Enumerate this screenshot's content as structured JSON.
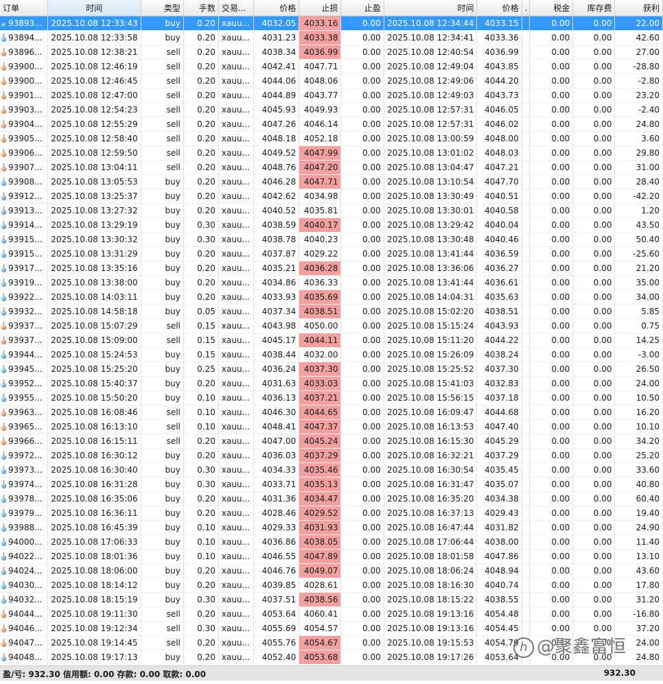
{
  "columns": {
    "order": "订单",
    "time": "时间",
    "type": "类型",
    "volume": "手数",
    "symbol": "交易...",
    "price": "价格",
    "sl": "止损",
    "tp": "止盈",
    "close_time": "时间",
    "close_price": "价格",
    "dot": ".",
    "tax": "税金",
    "swap": "库存费",
    "profit": "获利"
  },
  "rows": [
    {
      "order": "93893...",
      "time": "2025.10.08 12:33:43",
      "type": "buy",
      "volume": "0.20",
      "symbol": "xauu...",
      "price": "4032.05",
      "sl": "4033.16",
      "tp": "0.00",
      "close_time": "2025.10.08 12:34:44",
      "close_price": "4033.15",
      "tax": "0.00",
      "swap": "0.00",
      "profit": "22.00",
      "sl_hl": true,
      "selected": true
    },
    {
      "order": "93894...",
      "time": "2025.10.08 12:33:58",
      "type": "buy",
      "volume": "0.20",
      "symbol": "xauu...",
      "price": "4031.23",
      "sl": "4033.38",
      "tp": "0.00",
      "close_time": "2025.10.08 12:34:41",
      "close_price": "4033.36",
      "tax": "0.00",
      "swap": "0.00",
      "profit": "42.60",
      "sl_hl": true
    },
    {
      "order": "93896...",
      "time": "2025.10.08 12:38:21",
      "type": "sell",
      "volume": "0.20",
      "symbol": "xauu...",
      "price": "4038.34",
      "sl": "4036.99",
      "tp": "0.00",
      "close_time": "2025.10.08 12:40:54",
      "close_price": "4036.99",
      "tax": "0.00",
      "swap": "0.00",
      "profit": "27.00",
      "sl_hl": true
    },
    {
      "order": "93900...",
      "time": "2025.10.08 12:46:19",
      "type": "sell",
      "volume": "0.20",
      "symbol": "xauu...",
      "price": "4042.41",
      "sl": "4047.71",
      "tp": "0.00",
      "close_time": "2025.10.08 12:49:04",
      "close_price": "4043.85",
      "tax": "0.00",
      "swap": "0.00",
      "profit": "-28.80",
      "sl_hl": false
    },
    {
      "order": "93900...",
      "time": "2025.10.08 12:46:45",
      "type": "sell",
      "volume": "0.20",
      "symbol": "xauu...",
      "price": "4044.06",
      "sl": "4048.06",
      "tp": "0.00",
      "close_time": "2025.10.08 12:49:06",
      "close_price": "4044.20",
      "tax": "0.00",
      "swap": "0.00",
      "profit": "-2.80",
      "sl_hl": false
    },
    {
      "order": "93901...",
      "time": "2025.10.08 12:47:00",
      "type": "sell",
      "volume": "0.20",
      "symbol": "xauu...",
      "price": "4044.89",
      "sl": "4043.77",
      "tp": "0.00",
      "close_time": "2025.10.08 12:49:03",
      "close_price": "4043.73",
      "tax": "0.00",
      "swap": "0.00",
      "profit": "23.20",
      "sl_hl": false
    },
    {
      "order": "93903...",
      "time": "2025.10.08 12:54:23",
      "type": "sell",
      "volume": "0.20",
      "symbol": "xauu...",
      "price": "4045.93",
      "sl": "4049.93",
      "tp": "0.00",
      "close_time": "2025.10.08 12:57:31",
      "close_price": "4046.05",
      "tax": "0.00",
      "swap": "0.00",
      "profit": "-2.40",
      "sl_hl": false
    },
    {
      "order": "93904...",
      "time": "2025.10.08 12:55:29",
      "type": "sell",
      "volume": "0.20",
      "symbol": "xauu...",
      "price": "4047.26",
      "sl": "4046.14",
      "tp": "0.00",
      "close_time": "2025.10.08 12:57:31",
      "close_price": "4046.02",
      "tax": "0.00",
      "swap": "0.00",
      "profit": "24.80",
      "sl_hl": false
    },
    {
      "order": "93905...",
      "time": "2025.10.08 12:58:40",
      "type": "sell",
      "volume": "0.20",
      "symbol": "xauu...",
      "price": "4048.18",
      "sl": "4052.18",
      "tp": "0.00",
      "close_time": "2025.10.08 13:00:59",
      "close_price": "4048.00",
      "tax": "0.00",
      "swap": "0.00",
      "profit": "3.60",
      "sl_hl": false
    },
    {
      "order": "93906...",
      "time": "2025.10.08 12:59:50",
      "type": "sell",
      "volume": "0.20",
      "symbol": "xauu...",
      "price": "4049.52",
      "sl": "4047.99",
      "tp": "0.00",
      "close_time": "2025.10.08 13:01:02",
      "close_price": "4048.03",
      "tax": "0.00",
      "swap": "0.00",
      "profit": "29.80",
      "sl_hl": true
    },
    {
      "order": "93907...",
      "time": "2025.10.08 13:04:11",
      "type": "sell",
      "volume": "0.20",
      "symbol": "xauu...",
      "price": "4048.76",
      "sl": "4047.20",
      "tp": "0.00",
      "close_time": "2025.10.08 13:04:47",
      "close_price": "4047.21",
      "tax": "0.00",
      "swap": "0.00",
      "profit": "31.00",
      "sl_hl": true
    },
    {
      "order": "93908...",
      "time": "2025.10.08 13:05:53",
      "type": "buy",
      "volume": "0.20",
      "symbol": "xauu...",
      "price": "4046.28",
      "sl": "4047.71",
      "tp": "0.00",
      "close_time": "2025.10.08 13:10:54",
      "close_price": "4047.70",
      "tax": "0.00",
      "swap": "0.00",
      "profit": "28.40",
      "sl_hl": true
    },
    {
      "order": "93912...",
      "time": "2025.10.08 13:25:37",
      "type": "buy",
      "volume": "0.20",
      "symbol": "xauu...",
      "price": "4042.62",
      "sl": "4034.98",
      "tp": "0.00",
      "close_time": "2025.10.08 13:30:49",
      "close_price": "4040.51",
      "tax": "0.00",
      "swap": "0.00",
      "profit": "-42.20",
      "sl_hl": false
    },
    {
      "order": "93913...",
      "time": "2025.10.08 13:27:32",
      "type": "buy",
      "volume": "0.20",
      "symbol": "xauu...",
      "price": "4040.52",
      "sl": "4035.81",
      "tp": "0.00",
      "close_time": "2025.10.08 13:30:01",
      "close_price": "4040.58",
      "tax": "0.00",
      "swap": "0.00",
      "profit": "1.20",
      "sl_hl": false
    },
    {
      "order": "93914...",
      "time": "2025.10.08 13:29:19",
      "type": "buy",
      "volume": "0.30",
      "symbol": "xauu...",
      "price": "4038.59",
      "sl": "4040.17",
      "tp": "0.00",
      "close_time": "2025.10.08 13:29:42",
      "close_price": "4040.04",
      "tax": "0.00",
      "swap": "0.00",
      "profit": "43.50",
      "sl_hl": true
    },
    {
      "order": "93915...",
      "time": "2025.10.08 13:30:32",
      "type": "buy",
      "volume": "0.30",
      "symbol": "xauu...",
      "price": "4038.78",
      "sl": "4040.23",
      "tp": "0.00",
      "close_time": "2025.10.08 13:30:48",
      "close_price": "4040.46",
      "tax": "0.00",
      "swap": "0.00",
      "profit": "50.40",
      "sl_hl": false
    },
    {
      "order": "93915...",
      "time": "2025.10.08 13:31:29",
      "type": "buy",
      "volume": "0.20",
      "symbol": "xauu...",
      "price": "4037.87",
      "sl": "4029.22",
      "tp": "0.00",
      "close_time": "2025.10.08 13:41:44",
      "close_price": "4036.59",
      "tax": "0.00",
      "swap": "0.00",
      "profit": "-25.60",
      "sl_hl": false
    },
    {
      "order": "93917...",
      "time": "2025.10.08 13:35:16",
      "type": "buy",
      "volume": "0.20",
      "symbol": "xauu...",
      "price": "4035.21",
      "sl": "4036.28",
      "tp": "0.00",
      "close_time": "2025.10.08 13:36:06",
      "close_price": "4036.27",
      "tax": "0.00",
      "swap": "0.00",
      "profit": "21.20",
      "sl_hl": true
    },
    {
      "order": "93919...",
      "time": "2025.10.08 13:38:00",
      "type": "buy",
      "volume": "0.20",
      "symbol": "xauu...",
      "price": "4034.86",
      "sl": "4036.33",
      "tp": "0.00",
      "close_time": "2025.10.08 13:41:44",
      "close_price": "4036.61",
      "tax": "0.00",
      "swap": "0.00",
      "profit": "35.00",
      "sl_hl": false
    },
    {
      "order": "93922...",
      "time": "2025.10.08 14:03:11",
      "type": "buy",
      "volume": "0.20",
      "symbol": "xauu...",
      "price": "4033.93",
      "sl": "4035.69",
      "tp": "0.00",
      "close_time": "2025.10.08 14:04:31",
      "close_price": "4035.63",
      "tax": "0.00",
      "swap": "0.00",
      "profit": "34.00",
      "sl_hl": true
    },
    {
      "order": "93932...",
      "time": "2025.10.08 14:58:18",
      "type": "buy",
      "volume": "0.05",
      "symbol": "xauu...",
      "price": "4037.34",
      "sl": "4038.51",
      "tp": "0.00",
      "close_time": "2025.10.08 15:02:20",
      "close_price": "4038.51",
      "tax": "0.00",
      "swap": "0.00",
      "profit": "5.85",
      "sl_hl": true
    },
    {
      "order": "93937...",
      "time": "2025.10.08 15:07:29",
      "type": "sell",
      "volume": "0.15",
      "symbol": "xauu...",
      "price": "4043.98",
      "sl": "4050.00",
      "tp": "0.00",
      "close_time": "2025.10.08 15:15:24",
      "close_price": "4043.93",
      "tax": "0.00",
      "swap": "0.00",
      "profit": "0.75",
      "sl_hl": false
    },
    {
      "order": "93937...",
      "time": "2025.10.08 15:09:00",
      "type": "sell",
      "volume": "0.15",
      "symbol": "xauu...",
      "price": "4045.17",
      "sl": "4044.11",
      "tp": "0.00",
      "close_time": "2025.10.08 15:11:20",
      "close_price": "4044.22",
      "tax": "0.00",
      "swap": "0.00",
      "profit": "14.25",
      "sl_hl": true
    },
    {
      "order": "93944...",
      "time": "2025.10.08 15:24:53",
      "type": "buy",
      "volume": "0.15",
      "symbol": "xauu...",
      "price": "4038.44",
      "sl": "4032.00",
      "tp": "0.00",
      "close_time": "2025.10.08 15:26:09",
      "close_price": "4038.24",
      "tax": "0.00",
      "swap": "0.00",
      "profit": "-3.00",
      "sl_hl": false
    },
    {
      "order": "93945...",
      "time": "2025.10.08 15:25:20",
      "type": "buy",
      "volume": "0.25",
      "symbol": "xauu...",
      "price": "4036.24",
      "sl": "4037.30",
      "tp": "0.00",
      "close_time": "2025.10.08 15:25:52",
      "close_price": "4037.30",
      "tax": "0.00",
      "swap": "0.00",
      "profit": "26.50",
      "sl_hl": true
    },
    {
      "order": "93952...",
      "time": "2025.10.08 15:40:37",
      "type": "buy",
      "volume": "0.20",
      "symbol": "xauu...",
      "price": "4031.63",
      "sl": "4033.03",
      "tp": "0.00",
      "close_time": "2025.10.08 15:41:03",
      "close_price": "4032.83",
      "tax": "0.00",
      "swap": "0.00",
      "profit": "24.00",
      "sl_hl": true
    },
    {
      "order": "93955...",
      "time": "2025.10.08 15:50:20",
      "type": "buy",
      "volume": "0.10",
      "symbol": "xauu...",
      "price": "4036.13",
      "sl": "4037.21",
      "tp": "0.00",
      "close_time": "2025.10.08 15:56:15",
      "close_price": "4037.18",
      "tax": "0.00",
      "swap": "0.00",
      "profit": "10.50",
      "sl_hl": true
    },
    {
      "order": "93963...",
      "time": "2025.10.08 16:08:46",
      "type": "sell",
      "volume": "0.10",
      "symbol": "xauu...",
      "price": "4046.30",
      "sl": "4044.65",
      "tp": "0.00",
      "close_time": "2025.10.08 16:09:47",
      "close_price": "4044.68",
      "tax": "0.00",
      "swap": "0.00",
      "profit": "16.20",
      "sl_hl": true
    },
    {
      "order": "93965...",
      "time": "2025.10.08 16:13:10",
      "type": "sell",
      "volume": "0.10",
      "symbol": "xauu...",
      "price": "4048.41",
      "sl": "4047.37",
      "tp": "0.00",
      "close_time": "2025.10.08 16:13:53",
      "close_price": "4047.40",
      "tax": "0.00",
      "swap": "0.00",
      "profit": "10.10",
      "sl_hl": true
    },
    {
      "order": "93966...",
      "time": "2025.10.08 16:15:11",
      "type": "sell",
      "volume": "0.20",
      "symbol": "xauu...",
      "price": "4047.00",
      "sl": "4045.24",
      "tp": "0.00",
      "close_time": "2025.10.08 16:15:30",
      "close_price": "4045.29",
      "tax": "0.00",
      "swap": "0.00",
      "profit": "34.20",
      "sl_hl": true
    },
    {
      "order": "93972...",
      "time": "2025.10.08 16:30:12",
      "type": "buy",
      "volume": "0.20",
      "symbol": "xauu...",
      "price": "4036.03",
      "sl": "4037.29",
      "tp": "0.00",
      "close_time": "2025.10.08 16:32:21",
      "close_price": "4037.29",
      "tax": "0.00",
      "swap": "0.00",
      "profit": "25.20",
      "sl_hl": true
    },
    {
      "order": "93973...",
      "time": "2025.10.08 16:30:40",
      "type": "buy",
      "volume": "0.30",
      "symbol": "xauu...",
      "price": "4034.33",
      "sl": "4035.46",
      "tp": "0.00",
      "close_time": "2025.10.08 16:30:54",
      "close_price": "4035.45",
      "tax": "0.00",
      "swap": "0.00",
      "profit": "33.60",
      "sl_hl": true
    },
    {
      "order": "93974...",
      "time": "2025.10.08 16:31:28",
      "type": "buy",
      "volume": "0.30",
      "symbol": "xauu...",
      "price": "4033.71",
      "sl": "4035.13",
      "tp": "0.00",
      "close_time": "2025.10.08 16:31:47",
      "close_price": "4035.07",
      "tax": "0.00",
      "swap": "0.00",
      "profit": "40.80",
      "sl_hl": true
    },
    {
      "order": "93978...",
      "time": "2025.10.08 16:35:06",
      "type": "buy",
      "volume": "0.20",
      "symbol": "xauu...",
      "price": "4031.36",
      "sl": "4034.47",
      "tp": "0.00",
      "close_time": "2025.10.08 16:35:20",
      "close_price": "4034.38",
      "tax": "0.00",
      "swap": "0.00",
      "profit": "60.40",
      "sl_hl": true
    },
    {
      "order": "93979...",
      "time": "2025.10.08 16:36:11",
      "type": "buy",
      "volume": "0.20",
      "symbol": "xauu...",
      "price": "4028.46",
      "sl": "4029.52",
      "tp": "0.00",
      "close_time": "2025.10.08 16:37:13",
      "close_price": "4029.43",
      "tax": "0.00",
      "swap": "0.00",
      "profit": "19.40",
      "sl_hl": true
    },
    {
      "order": "93988...",
      "time": "2025.10.08 16:45:39",
      "type": "buy",
      "volume": "0.10",
      "symbol": "xauu...",
      "price": "4029.33",
      "sl": "4031.93",
      "tp": "0.00",
      "close_time": "2025.10.08 16:47:44",
      "close_price": "4031.82",
      "tax": "0.00",
      "swap": "0.00",
      "profit": "24.90",
      "sl_hl": true
    },
    {
      "order": "94000...",
      "time": "2025.10.08 17:06:33",
      "type": "buy",
      "volume": "0.10",
      "symbol": "xauu...",
      "price": "4036.86",
      "sl": "4038.05",
      "tp": "0.00",
      "close_time": "2025.10.08 17:06:44",
      "close_price": "4038.00",
      "tax": "0.00",
      "swap": "0.00",
      "profit": "11.40",
      "sl_hl": true
    },
    {
      "order": "94022...",
      "time": "2025.10.08 18:01:36",
      "type": "buy",
      "volume": "0.10",
      "symbol": "xauu...",
      "price": "4046.55",
      "sl": "4047.89",
      "tp": "0.00",
      "close_time": "2025.10.08 18:01:58",
      "close_price": "4047.86",
      "tax": "0.00",
      "swap": "0.00",
      "profit": "13.10",
      "sl_hl": true
    },
    {
      "order": "94024...",
      "time": "2025.10.08 18:06:00",
      "type": "buy",
      "volume": "0.20",
      "symbol": "xauu...",
      "price": "4046.76",
      "sl": "4049.07",
      "tp": "0.00",
      "close_time": "2025.10.08 18:06:24",
      "close_price": "4048.94",
      "tax": "0.00",
      "swap": "0.00",
      "profit": "43.60",
      "sl_hl": true
    },
    {
      "order": "94030...",
      "time": "2025.10.08 18:14:12",
      "type": "buy",
      "volume": "0.20",
      "symbol": "xauu...",
      "price": "4039.85",
      "sl": "4028.61",
      "tp": "0.00",
      "close_time": "2025.10.08 18:16:30",
      "close_price": "4040.74",
      "tax": "0.00",
      "swap": "0.00",
      "profit": "17.80",
      "sl_hl": false
    },
    {
      "order": "94032...",
      "time": "2025.10.08 18:15:19",
      "type": "buy",
      "volume": "0.30",
      "symbol": "xauu...",
      "price": "4037.51",
      "sl": "4038.56",
      "tp": "0.00",
      "close_time": "2025.10.08 18:15:22",
      "close_price": "4038.55",
      "tax": "0.00",
      "swap": "0.00",
      "profit": "31.20",
      "sl_hl": true
    },
    {
      "order": "94044...",
      "time": "2025.10.08 19:11:30",
      "type": "sell",
      "volume": "0.20",
      "symbol": "xauu...",
      "price": "4053.64",
      "sl": "4060.41",
      "tp": "0.00",
      "close_time": "2025.10.08 19:13:16",
      "close_price": "4054.48",
      "tax": "0.00",
      "swap": "0.00",
      "profit": "-16.80",
      "sl_hl": false
    },
    {
      "order": "94046...",
      "time": "2025.10.08 19:12:34",
      "type": "sell",
      "volume": "0.30",
      "symbol": "xauu...",
      "price": "4055.69",
      "sl": "4054.57",
      "tp": "0.00",
      "close_time": "2025.10.08 19:13:16",
      "close_price": "4054.45",
      "tax": "0.00",
      "swap": "0.00",
      "profit": "37.20",
      "sl_hl": false
    },
    {
      "order": "94047...",
      "time": "2025.10.08 19:14:45",
      "type": "sell",
      "volume": "0.20",
      "symbol": "xauu...",
      "price": "4055.76",
      "sl": "4054.67",
      "tp": "0.00",
      "close_time": "2025.10.08 19:15:53",
      "close_price": "4054.79",
      "tax": "0.00",
      "swap": "0.00",
      "profit": "24.00",
      "sl_hl": true
    },
    {
      "order": "94048...",
      "time": "2025.10.08 19:17:13",
      "type": "buy",
      "volume": "0.20",
      "symbol": "xauu...",
      "price": "4052.40",
      "sl": "4053.68",
      "tp": "0.00",
      "close_time": "2025.10.08 19:17:26",
      "close_price": "4053.64",
      "tax": "0.00",
      "swap": "0.00",
      "profit": "24.80",
      "sl_hl": true
    }
  ],
  "footer": {
    "summary": "盈/亏: 932.30  信用额: 0.00  存款: 0.00  取款: 0.00",
    "total_profit": "932.30"
  },
  "watermark": {
    "logo": "h",
    "text": "@聚鑫富恒"
  },
  "colors": {
    "selected_row": "#3399ff",
    "stop_loss_highlight": "#f4a0a0",
    "buy_icon": "#1c6fc9",
    "sell_icon": "#d4500e"
  }
}
